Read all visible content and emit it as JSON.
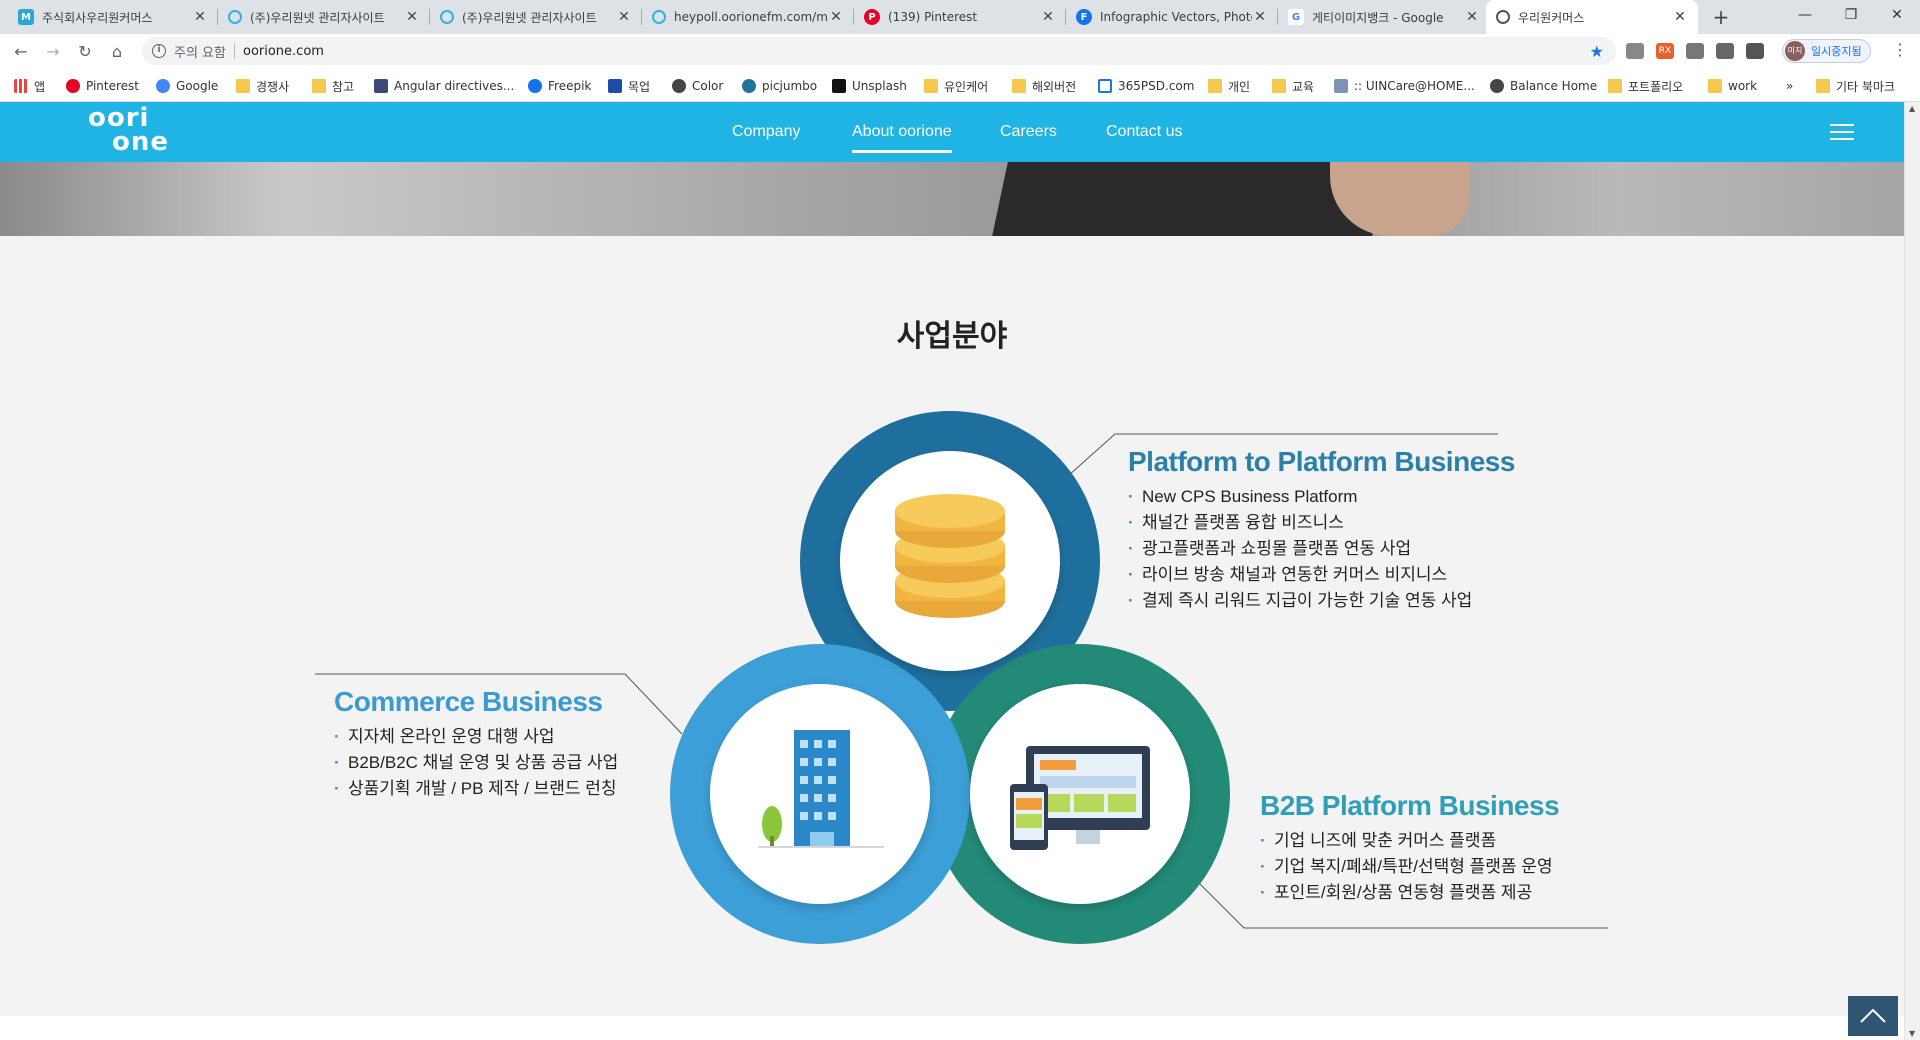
{
  "browser": {
    "tabs": [
      {
        "title": "주식회사우리원커머스",
        "icon_color": "#28a8d8",
        "icon_letter": "M"
      },
      {
        "title": "(주)우리원넷 관리자사이트",
        "icon_color": "#29b6e5",
        "icon_letter": ""
      },
      {
        "title": "(주)우리원넷 관리자사이트",
        "icon_color": "#29b6e5",
        "icon_letter": ""
      },
      {
        "title": "heypoll.oorionefm.com/m/",
        "icon_color": "#29b6e5",
        "icon_letter": ""
      },
      {
        "title": "(139) Pinterest",
        "icon_color": "#e60023",
        "icon_letter": "P"
      },
      {
        "title": "Infographic Vectors, Photo",
        "icon_color": "#1273eb",
        "icon_letter": "F"
      },
      {
        "title": "게티이미지뱅크 - Google",
        "icon_color": "#4285f4",
        "icon_letter": "G"
      },
      {
        "title": "우리원커머스",
        "icon_color": "#555555",
        "icon_letter": ""
      }
    ],
    "new_tab": "+",
    "window_controls": {
      "minimize": "—",
      "maximize": "❐",
      "close": "✕"
    },
    "address": {
      "security_text": "주의 요함",
      "url": "oorione.com"
    },
    "profile_label": "일시중지됨",
    "profile_avatar": "미지",
    "bookmarks": [
      {
        "label": "앱",
        "type": "apps",
        "color": "#e8453c"
      },
      {
        "label": "Pinterest",
        "type": "site",
        "color": "#e60023"
      },
      {
        "label": "Google",
        "type": "site",
        "color": "#4285f4"
      },
      {
        "label": "경쟁사",
        "type": "folder",
        "color": "#f6c84d"
      },
      {
        "label": "참고",
        "type": "folder",
        "color": "#f6c84d"
      },
      {
        "label": "Angular directives...",
        "type": "site",
        "color": "#3b4a7a"
      },
      {
        "label": "Freepik",
        "type": "site",
        "color": "#1273eb"
      },
      {
        "label": "목업",
        "type": "site",
        "color": "#1e4ba8"
      },
      {
        "label": "Color",
        "type": "site",
        "color": "#444444"
      },
      {
        "label": "picjumbo",
        "type": "site",
        "color": "#21759b"
      },
      {
        "label": "Unsplash",
        "type": "site",
        "color": "#111111"
      },
      {
        "label": "유인케어",
        "type": "folder",
        "color": "#f6c84d"
      },
      {
        "label": "해외버전",
        "type": "folder",
        "color": "#f6c84d"
      },
      {
        "label": "365PSD.com",
        "type": "site",
        "color": "#1a73e8"
      },
      {
        "label": "개인",
        "type": "folder",
        "color": "#f6c84d"
      },
      {
        "label": "교육",
        "type": "folder",
        "color": "#f6c84d"
      },
      {
        "label": ":: UINCare@HOME...",
        "type": "site",
        "color": "#7d94b5"
      },
      {
        "label": "Balance Home",
        "type": "site",
        "color": "#444444"
      },
      {
        "label": "포트폴리오",
        "type": "folder",
        "color": "#f6c84d"
      },
      {
        "label": "work",
        "type": "folder",
        "color": "#f6c84d"
      }
    ],
    "bookmarks_overflow": "»",
    "other_bookmarks": "기타 북마크"
  },
  "site": {
    "logo_line1": "oori",
    "logo_line2": "one",
    "nav": [
      {
        "label": "Company",
        "active": false
      },
      {
        "label": "About oorione",
        "active": true
      },
      {
        "label": "Careers",
        "active": false
      },
      {
        "label": "Contact us",
        "active": false
      }
    ],
    "brand_color": "#1fb4e3",
    "section_title": "사업분야",
    "businesses": {
      "platform": {
        "title": "Platform to Platform Business",
        "color": "#2c7fa8",
        "items": [
          "New CPS Business Platform",
          "채널간 플랫폼 융합 비즈니스",
          "광고플랫폼과 쇼핑몰 플랫폼 연동 사업",
          "라이브 방송 채널과 연동한 커머스 비지니스",
          "결제 즉시 리워드 지급이 가능한 기술 연동 사업"
        ]
      },
      "commerce": {
        "title": "Commerce Business",
        "color": "#3a9ad3",
        "items": [
          "지자체 온라인 운영 대행 사업",
          "B2B/B2C 채널 운영 및 상품 공급 사업",
          "상품기획 개발 / PB 제작 / 브랜드 런칭"
        ]
      },
      "b2b": {
        "title": "B2B Platform Business",
        "color": "#2f9fb8",
        "items": [
          "기업 니즈에 맞춘 커머스 플랫폼",
          "기업 복지/폐쇄/특판/선택형 플랫폼 운영",
          "포인트/회원/상품 연동형 플랫폼 제공"
        ]
      }
    },
    "ring_colors": {
      "platform": "#1f6f9e",
      "commerce": "#3d9fd8",
      "b2b": "#238a78"
    },
    "icons": {
      "platform": "coins-icon",
      "commerce": "office-building-icon",
      "b2b": "devices-icon"
    }
  }
}
